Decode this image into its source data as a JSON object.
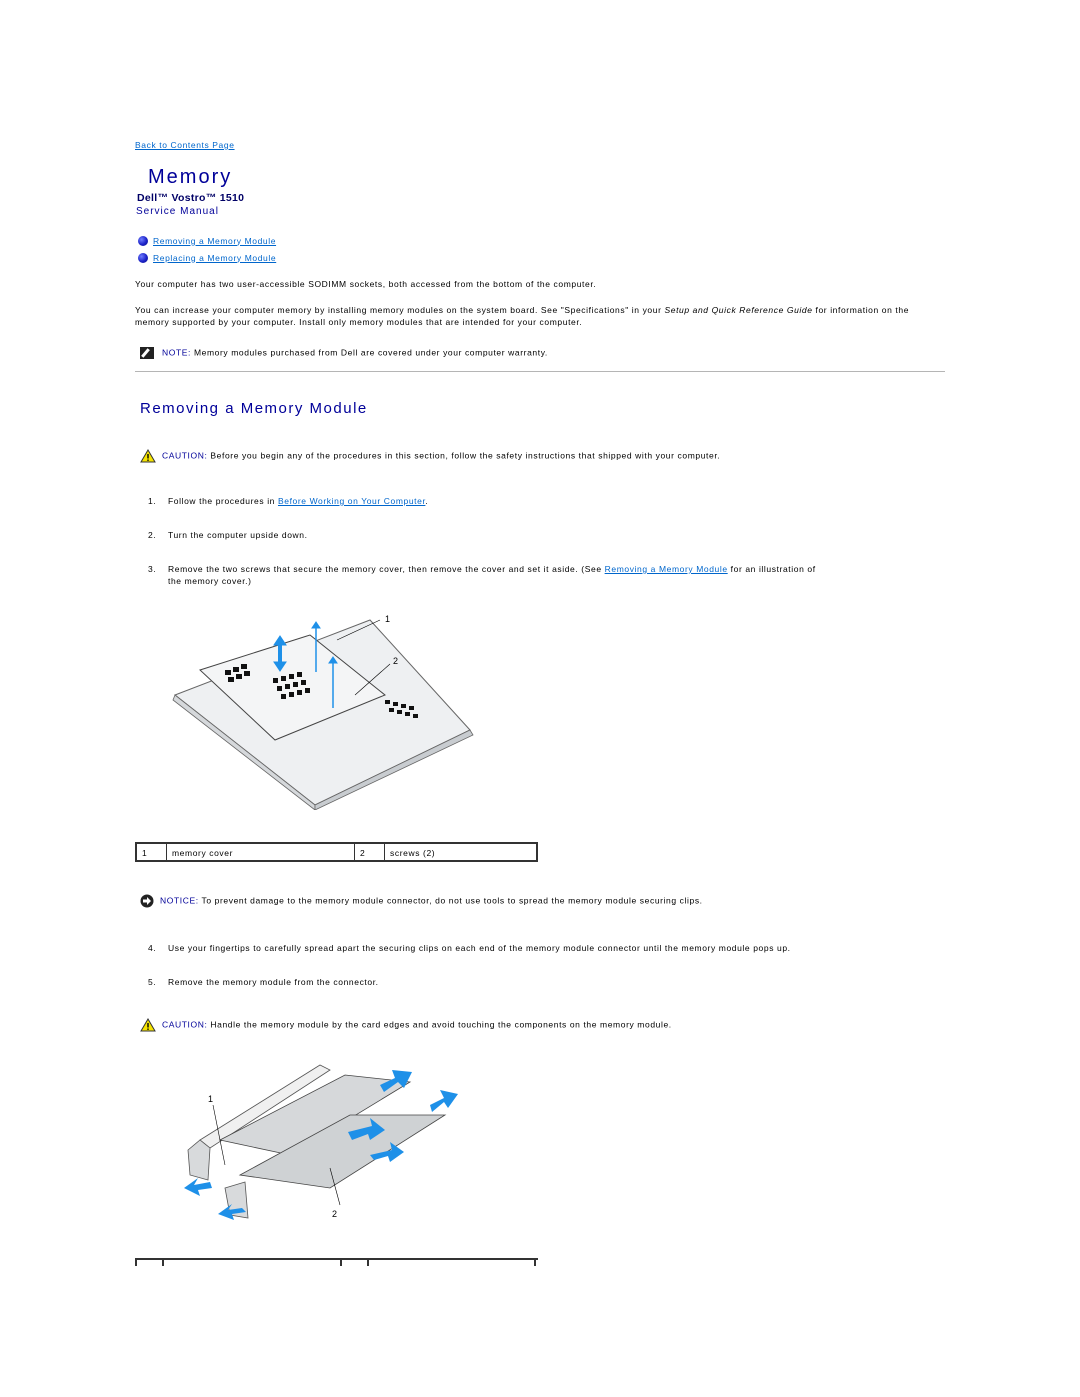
{
  "nav": {
    "back_link": "Back to Contents Page"
  },
  "header": {
    "title": "Memory",
    "product": "Dell™ Vostro™ 1510",
    "manual": "Service Manual"
  },
  "toc": [
    {
      "label": "Removing a Memory Module"
    },
    {
      "label": "Replacing a Memory Module"
    }
  ],
  "intro": {
    "p1": "Your computer has two user-accessible SODIMM sockets, both accessed from the bottom of the computer.",
    "p2_before": "You can increase your computer memory by installing memory modules on the system board. See \"Specifications\" in your ",
    "p2_italic": "Setup and Quick Reference Guide",
    "p2_after": " for information on the memory supported by your computer. Install only memory modules that are intended for your computer.",
    "note_label": "NOTE:",
    "note_text": " Memory modules purchased from Dell are covered under your computer warranty."
  },
  "section": {
    "title": "Removing a Memory Module",
    "caution1_label": "CAUTION:",
    "caution1_text": " Before you begin any of the procedures in this section, follow the safety instructions that shipped with your computer.",
    "steps": [
      {
        "num": "1.",
        "before": "Follow the procedures in ",
        "link": "Before Working on Your Computer",
        "after": "."
      },
      {
        "num": "2.",
        "text": "Turn the computer upside down."
      },
      {
        "num": "3.",
        "before": "Remove the two screws that secure the memory cover, then remove the cover and set it aside. (See ",
        "link": "Removing a Memory Module",
        "after": " for an illustration of",
        "line2": "the memory cover.)"
      },
      {
        "num": "4.",
        "text": "Use your fingertips to carefully spread apart the securing clips on each end of the memory module connector until the memory module pops up."
      },
      {
        "num": "5.",
        "text": "Remove the memory module from the connector."
      }
    ],
    "figure1": {
      "callouts": [
        "1",
        "2"
      ]
    },
    "legend1": [
      {
        "num": "1",
        "label": "memory cover"
      },
      {
        "num": "2",
        "label": "screws (2)"
      }
    ],
    "notice_label": "NOTICE:",
    "notice_text": " To prevent damage to the memory module connector, do not use tools to spread the memory module securing clips.",
    "caution2_label": "CAUTION:",
    "caution2_text": " Handle the memory module by the card edges and avoid touching the components on the memory module.",
    "figure2": {
      "callouts": [
        "1",
        "2"
      ]
    }
  },
  "colors": {
    "link": "#0066cc",
    "heading": "#000099",
    "arrow": "#1e90e8"
  }
}
